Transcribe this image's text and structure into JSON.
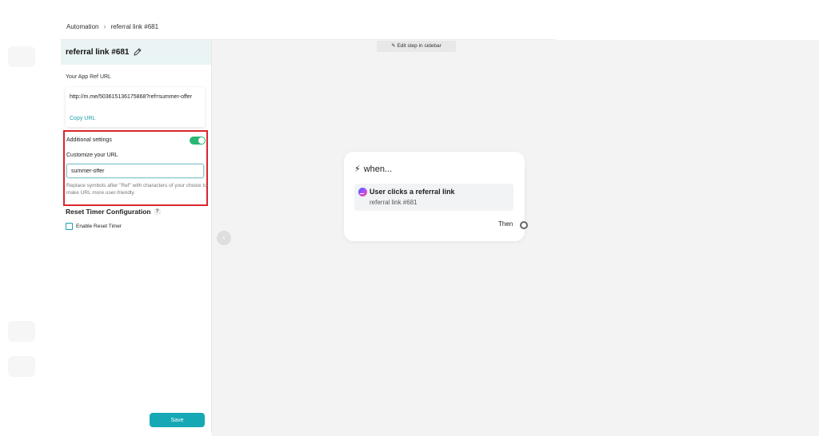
{
  "breadcrumb": {
    "root": "Automation",
    "current": "referral link #681"
  },
  "sidebar": {
    "title": "referral link #681",
    "ref_url_label": "Your App Ref URL",
    "ref_url": "http://m.me/503615136175868?ref=summer-offer",
    "copy_url": "Copy URL",
    "additional_settings_label": "Additional settings",
    "additional_settings_enabled": true,
    "customize_label": "Customize your URL",
    "customize_value": "summer-offer",
    "help_text": "Replace symbols after \"Ref\" with characters of your choice to make URL more user-friendly.",
    "reset_title": "Reset Timer Configuration",
    "reset_help": "?",
    "enable_reset_label": "Enable Reset Timer",
    "enable_reset_checked": false,
    "save_label": "Save"
  },
  "canvas": {
    "edit_hint": "✎ Edit step in sidebar",
    "collapse_arrow": "‹",
    "node": {
      "heading": "when...",
      "trigger_title": "User clicks a referral link",
      "trigger_sub": "referral link #681",
      "then_label": "Then"
    }
  },
  "colors": {
    "accent": "#17a8b6",
    "toggle_on": "#2bb673",
    "highlight_border": "#d9262c",
    "canvas_bg": "#f3f3f3",
    "panel_header_bg": "#eaf4f5"
  }
}
